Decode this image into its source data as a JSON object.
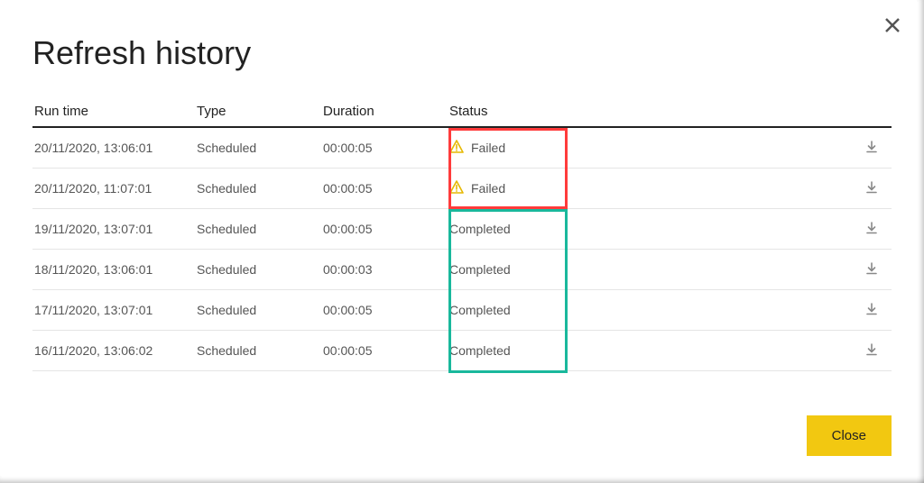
{
  "title": "Refresh history",
  "columns": {
    "runtime": "Run time",
    "type": "Type",
    "duration": "Duration",
    "status": "Status"
  },
  "status_labels": {
    "failed": "Failed",
    "completed": "Completed"
  },
  "rows": [
    {
      "runtime": "20/11/2020, 13:06:01",
      "type": "Scheduled",
      "duration": "00:00:05",
      "status": "failed"
    },
    {
      "runtime": "20/11/2020, 11:07:01",
      "type": "Scheduled",
      "duration": "00:00:05",
      "status": "failed"
    },
    {
      "runtime": "19/11/2020, 13:07:01",
      "type": "Scheduled",
      "duration": "00:00:05",
      "status": "completed"
    },
    {
      "runtime": "18/11/2020, 13:06:01",
      "type": "Scheduled",
      "duration": "00:00:03",
      "status": "completed"
    },
    {
      "runtime": "17/11/2020, 13:07:01",
      "type": "Scheduled",
      "duration": "00:00:05",
      "status": "completed"
    },
    {
      "runtime": "16/11/2020, 13:06:02",
      "type": "Scheduled",
      "duration": "00:00:05",
      "status": "completed"
    }
  ],
  "buttons": {
    "close": "Close"
  },
  "colors": {
    "accent": "#f2c811",
    "highlight_failed": "#ff3b3b",
    "highlight_completed": "#19b89c"
  }
}
